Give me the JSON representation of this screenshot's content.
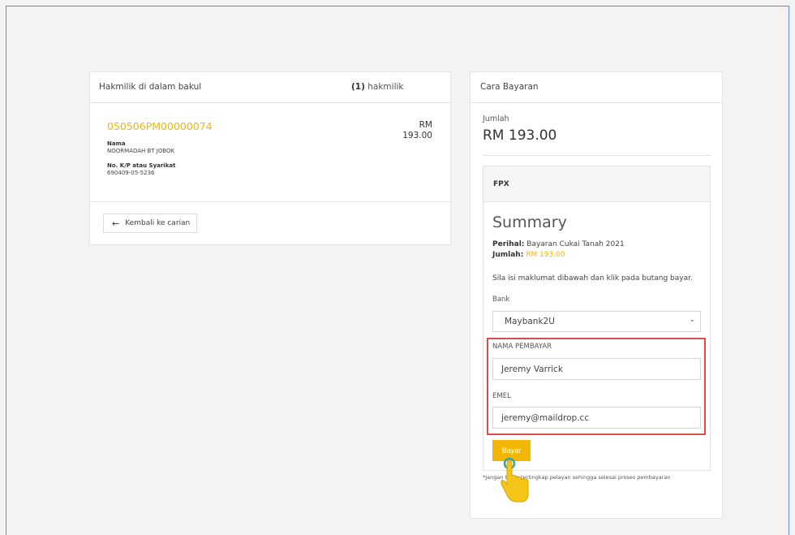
{
  "basket": {
    "title": "Hakmilik di dalam bakul",
    "count_num": "(1)",
    "count_label": "hakmilik",
    "item": {
      "id": "050506PM00000074",
      "price_currency": "RM",
      "price_amount": "193.00",
      "name_label": "Nama",
      "name_value": "NOORMADAH BT JOBOK",
      "ic_label": "No. K/P atau Syarikat",
      "ic_value": "690409-05-5236"
    },
    "back_button": "Kembali ke carian"
  },
  "payment": {
    "title": "Cara Bayaran",
    "amount_label": "Jumlah",
    "amount_value": "RM 193.00",
    "fpx": {
      "header": "FPX",
      "summary_title": "Summary",
      "perihal_label": "Perihal:",
      "perihal_value": "Bayaran Cukai Tanah 2021",
      "jumlah_label": "Jumlah:",
      "jumlah_value": "RM 193.00",
      "instruction": "Sila isi maklumat dibawah dan klik pada butang bayar.",
      "bank_label": "Bank",
      "bank_selected": "Maybank2U",
      "payer_name_label": "NAMA PEMBAYAR",
      "payer_name_value": "Jeremy Varrick",
      "email_label": "EMEL",
      "email_value": "jeremy@maildrop.cc",
      "pay_button": "Bayar"
    },
    "footnote": "*Jangan tutup tertingkap pelayan sehingga selesai proses pembayaran"
  },
  "colors": {
    "accent": "#f2b705",
    "highlight_border": "#d94c4c",
    "frame_border": "#5b8fd0"
  },
  "icons": {
    "back": "arrow-left-icon",
    "select": "chevron-down-icon",
    "pointer": "hand-pointer-icon"
  }
}
